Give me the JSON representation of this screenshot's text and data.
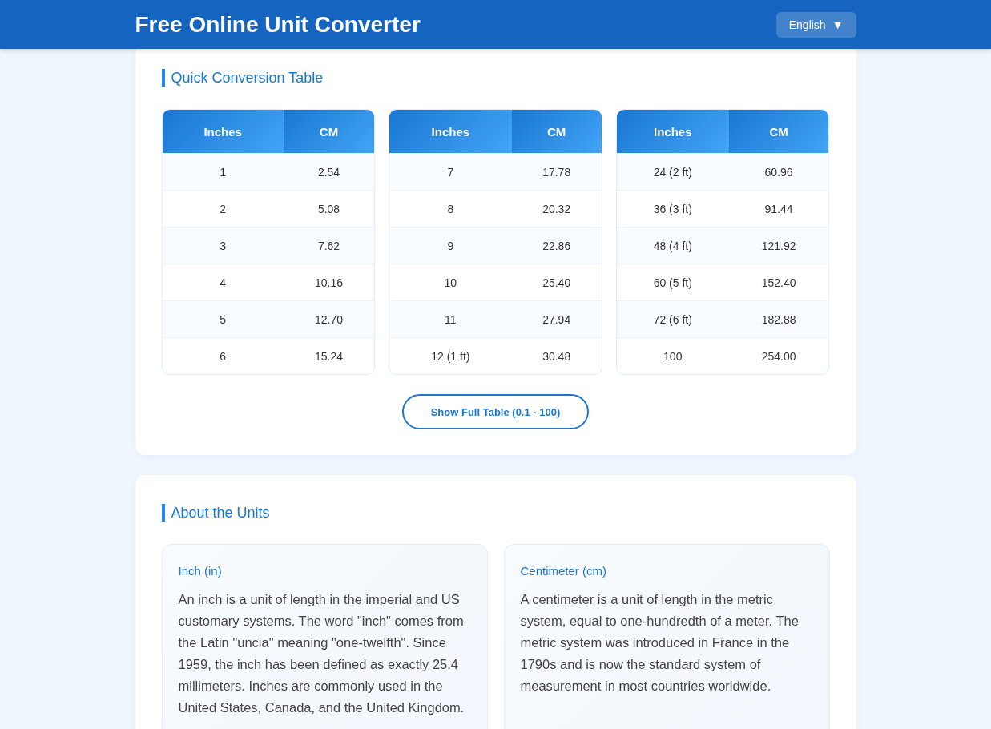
{
  "header": {
    "title": "Free Online Unit Converter",
    "language": {
      "label": "English",
      "caret": "▼"
    }
  },
  "quick_table": {
    "title": "Quick Conversion Table",
    "tables": [
      {
        "columns": [
          "Inches",
          "CM"
        ],
        "rows": [
          [
            "1",
            "2.54"
          ],
          [
            "2",
            "5.08"
          ],
          [
            "3",
            "7.62"
          ],
          [
            "4",
            "10.16"
          ],
          [
            "5",
            "12.70"
          ],
          [
            "6",
            "15.24"
          ]
        ]
      },
      {
        "columns": [
          "Inches",
          "CM"
        ],
        "rows": [
          [
            "7",
            "17.78"
          ],
          [
            "8",
            "20.32"
          ],
          [
            "9",
            "22.86"
          ],
          [
            "10",
            "25.40"
          ],
          [
            "11",
            "27.94"
          ],
          [
            "12 (1 ft)",
            "30.48"
          ]
        ]
      },
      {
        "columns": [
          "Inches",
          "CM"
        ],
        "rows": [
          [
            "24 (2 ft)",
            "60.96"
          ],
          [
            "36 (3 ft)",
            "91.44"
          ],
          [
            "48 (4 ft)",
            "121.92"
          ],
          [
            "60 (5 ft)",
            "152.40"
          ],
          [
            "72 (6 ft)",
            "182.88"
          ],
          [
            "100",
            "254.00"
          ]
        ]
      }
    ],
    "button": "Show Full Table (0.1 - 100)"
  },
  "about": {
    "title": "About the Units",
    "units": [
      {
        "title": "Inch (in)",
        "text": "An inch is a unit of length in the imperial and US customary systems. The word \"inch\" comes from the Latin \"uncia\" meaning \"one-twelfth\". Since 1959, the inch has been defined as exactly 25.4 millimeters. Inches are commonly used in the United States, Canada, and the United Kingdom."
      },
      {
        "title": "Centimeter (cm)",
        "text": "A centimeter is a unit of length in the metric system, equal to one-hundredth of a meter. The metric system was introduced in France in the 1790s and is now the standard system of measurement in most countries worldwide."
      }
    ]
  }
}
